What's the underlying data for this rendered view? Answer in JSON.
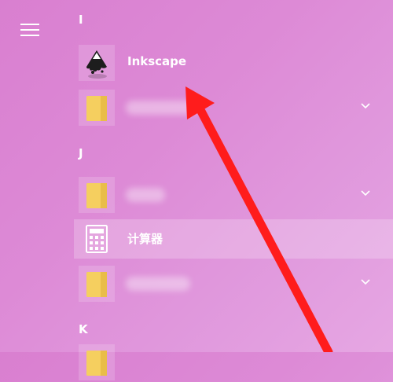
{
  "sections": [
    {
      "letter": "I"
    },
    {
      "letter": "J"
    },
    {
      "letter": "K"
    }
  ],
  "apps": {
    "inkscape": {
      "label": "Inkscape"
    },
    "calculator": {
      "label": "计算器"
    }
  },
  "colors": {
    "accent": "#ff1c1c",
    "folder": "#f5cf5f",
    "background": "#dd8ad6"
  }
}
